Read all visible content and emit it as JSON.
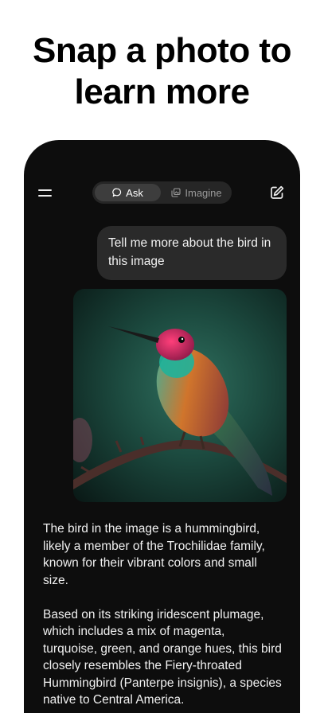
{
  "headline": {
    "line1": "Snap a photo to",
    "line2": "learn more"
  },
  "toolbar": {
    "ask_label": "Ask",
    "imagine_label": "Imagine"
  },
  "chat": {
    "user_message": "Tell me more about the bird in this image",
    "response_paragraph_1": "The bird in the image is a hummingbird, likely a member of the Trochilidae family, known for their vibrant colors and small size.",
    "response_paragraph_2": "Based on its striking iridescent plumage, which includes a mix of magenta, turquoise, green, and orange hues, this bird closely resembles the Fiery-throated Hummingbird (Panterpe insignis), a species native to Central America."
  },
  "colors": {
    "page_background": "#ffffff",
    "phone_background": "#0d0d0d",
    "bubble_background": "#2a2a2a",
    "toggle_background": "#262626",
    "toggle_active": "#3d3d3d"
  },
  "icons": [
    "menu-icon",
    "chat-bubble-icon",
    "image-stack-icon",
    "compose-icon"
  ]
}
